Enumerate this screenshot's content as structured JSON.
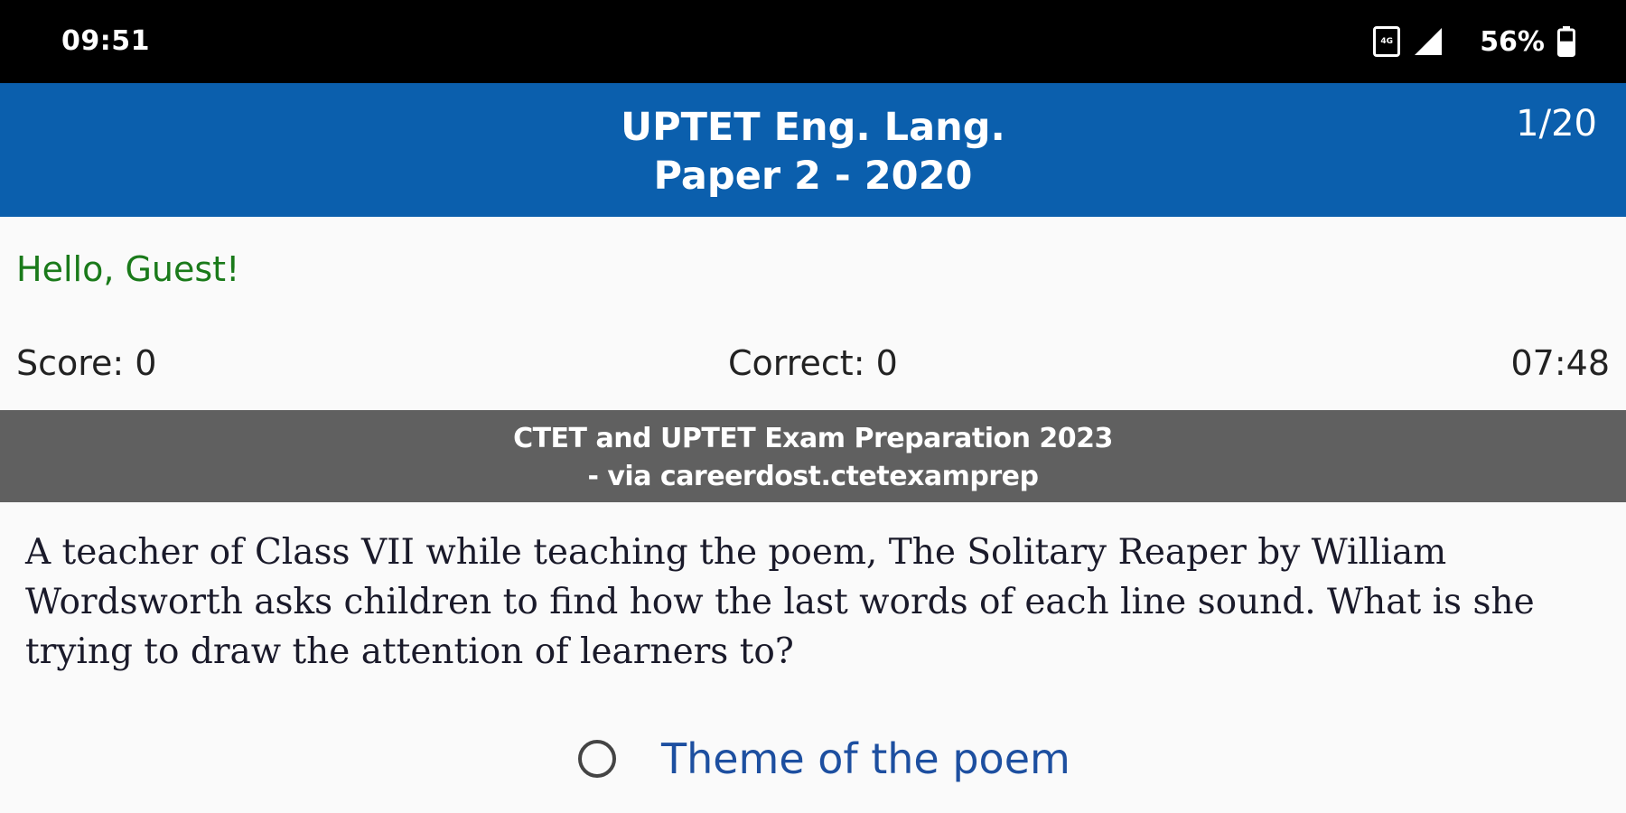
{
  "status_bar": {
    "time": "09:51",
    "data_icon_label": "4G",
    "battery_percent": "56%",
    "battery_level": 0.56,
    "icons": [
      "data-icon",
      "signal-icon",
      "battery-icon"
    ]
  },
  "header": {
    "title_line1": "UPTET Eng. Lang.",
    "title_line2": "Paper 2 - 2020",
    "counter": "1/20"
  },
  "greeting": "Hello, Guest!",
  "stats": {
    "score": "Score: 0",
    "correct": "Correct: 0",
    "timer": "07:48"
  },
  "banner": {
    "line1": "CTET and UPTET Exam Preparation 2023",
    "line2": "- via careerdost.ctetexamprep"
  },
  "question": {
    "text": "A teacher of Class VII while teaching the poem, The Solitary Reaper by William Wordsworth asks children to find how the last words of each line sound. What is she trying to draw the attention of learners to?"
  },
  "options": [
    {
      "label": "Theme of the poem",
      "selected": false
    }
  ],
  "colors": {
    "header_bg": "#0b5fad",
    "banner_bg": "#606060",
    "greeting": "#1a7a1a",
    "option_text": "#1d4fa0"
  }
}
